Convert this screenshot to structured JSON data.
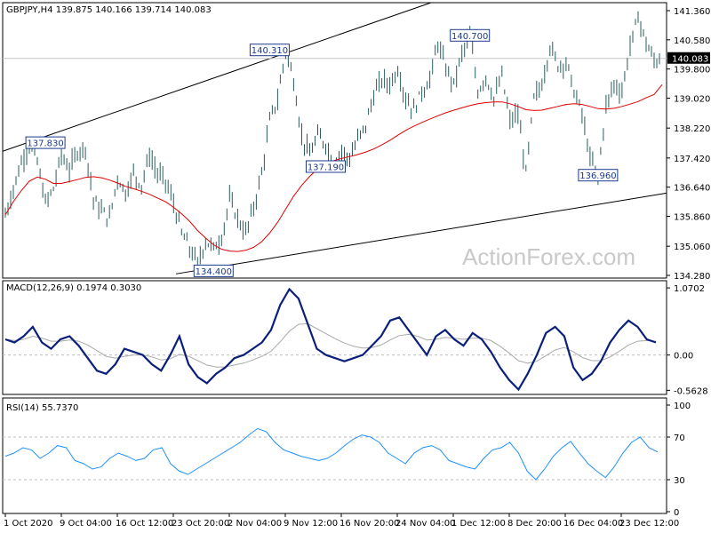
{
  "chart_data": [
    {
      "type": "line",
      "pane": "price",
      "title": "GBPJPY,H4  139.875 140.166 139.714 140.083",
      "symbol": "GBPJPY",
      "timeframe": "H4",
      "ohlc_header": {
        "open": 139.875,
        "high": 140.166,
        "low": 139.714,
        "close": 140.083
      },
      "last_price": "140.083",
      "watermark": "ActionForex.com",
      "ylim": [
        134.28,
        141.36
      ],
      "y_ticks": [
        "141.360",
        "140.580",
        "139.800",
        "139.020",
        "138.220",
        "137.420",
        "136.640",
        "135.860",
        "135.060",
        "134.280"
      ],
      "x_ticks": [
        "1 Oct 2020",
        "9 Oct 04:00",
        "16 Oct 12:00",
        "23 Oct 20:00",
        "2 Nov 04:00",
        "9 Nov 12:00",
        "16 Nov 20:00",
        "24 Nov 04:00",
        "1 Dec 12:00",
        "8 Dec 20:00",
        "16 Dec 04:00",
        "23 Dec 12:00"
      ],
      "price_path": [
        135.9,
        136.6,
        137.3,
        137.8,
        137.3,
        136.2,
        136.6,
        137.5,
        137.1,
        137.6,
        137.7,
        136.3,
        136.0,
        135.8,
        136.9,
        136.5,
        137.0,
        136.7,
        137.5,
        137.0,
        136.8,
        136.2,
        135.4,
        135.0,
        134.6,
        135.2,
        135.0,
        135.3,
        136.3,
        135.8,
        135.4,
        136.1,
        137.0,
        138.4,
        139.0,
        140.3,
        139.5,
        138.0,
        137.5,
        138.0,
        137.8,
        137.3,
        137.6,
        137.4,
        137.9,
        138.3,
        139.1,
        139.5,
        139.4,
        139.8,
        139.0,
        138.7,
        139.2,
        139.5,
        140.5,
        139.8,
        139.4,
        140.2,
        140.7,
        139.2,
        139.6,
        139.0,
        139.6,
        138.4,
        138.6,
        137.0,
        139.0,
        139.4,
        140.4,
        139.9,
        140.0,
        139.2,
        138.6,
        137.4,
        136.96,
        138.8,
        139.4,
        139.2,
        140.4,
        141.2,
        140.5,
        140.0,
        140.1
      ],
      "series": [
        {
          "name": "",
          "values": [
            135.9,
            136.25,
            136.55,
            136.8,
            136.91,
            136.85,
            136.74,
            136.74,
            136.79,
            136.84,
            136.9,
            136.92,
            136.89,
            136.83,
            136.75,
            136.66,
            136.6,
            136.53,
            136.45,
            136.35,
            136.25,
            136.1,
            135.93,
            135.73,
            135.48,
            135.28,
            135.1,
            134.98,
            134.93,
            134.92,
            134.95,
            135.03,
            135.18,
            135.41,
            135.7,
            136.05,
            136.4,
            136.69,
            136.93,
            137.13,
            137.27,
            137.35,
            137.41,
            137.46,
            137.51,
            137.58,
            137.66,
            137.77,
            137.89,
            138.03,
            138.16,
            138.27,
            138.37,
            138.46,
            138.55,
            138.63,
            138.7,
            138.76,
            138.82,
            138.87,
            138.9,
            138.92,
            138.92,
            138.87,
            138.8,
            138.71,
            138.69,
            138.7,
            138.75,
            138.8,
            138.85,
            138.87,
            138.85,
            138.8,
            138.74,
            138.73,
            138.75,
            138.8,
            138.86,
            138.93,
            139.03,
            139.12,
            139.38
          ]
        }
      ],
      "labels": [
        {
          "text": "137.830",
          "x": 5,
          "y": 137.83
        },
        {
          "text": "140.310",
          "x": 33,
          "y": 140.31
        },
        {
          "text": "140.700",
          "x": 58,
          "y": 140.7
        },
        {
          "text": "137.190",
          "x": 40,
          "y": 137.19
        },
        {
          "text": "136.960",
          "x": 74,
          "y": 136.96
        },
        {
          "text": "134.400",
          "x": 26,
          "y": 134.4
        }
      ]
    },
    {
      "type": "line",
      "pane": "macd",
      "title": "MACD(12,26,9) 0.1974 0.3030",
      "ylim": [
        -0.6,
        1.1
      ],
      "y_ticks": [
        "1.0702",
        "0.00",
        "-0.5628"
      ],
      "series": [
        {
          "name": "MACD",
          "values": [
            0.25,
            0.2,
            0.3,
            0.45,
            0.2,
            0.1,
            0.25,
            0.3,
            0.15,
            -0.05,
            -0.25,
            -0.3,
            -0.15,
            0.1,
            0.05,
            0.0,
            -0.15,
            -0.25,
            0.0,
            0.3,
            -0.15,
            -0.35,
            -0.45,
            -0.3,
            -0.2,
            -0.05,
            0.0,
            0.1,
            0.2,
            0.4,
            0.8,
            1.05,
            0.9,
            0.5,
            0.1,
            0.0,
            -0.05,
            -0.1,
            -0.05,
            0.0,
            0.15,
            0.3,
            0.55,
            0.6,
            0.4,
            0.2,
            0.0,
            0.3,
            0.4,
            0.25,
            0.15,
            0.35,
            0.25,
            0.05,
            -0.2,
            -0.4,
            -0.55,
            -0.3,
            0.0,
            0.35,
            0.45,
            0.3,
            -0.2,
            -0.4,
            -0.3,
            -0.1,
            0.2,
            0.4,
            0.55,
            0.45,
            0.25,
            0.2
          ]
        },
        {
          "name": "Signal",
          "values": [
            0.25,
            0.23,
            0.25,
            0.3,
            0.27,
            0.22,
            0.22,
            0.24,
            0.22,
            0.16,
            0.07,
            -0.02,
            -0.05,
            -0.02,
            0.0,
            0.0,
            -0.03,
            -0.08,
            -0.06,
            0.01,
            -0.02,
            -0.09,
            -0.16,
            -0.19,
            -0.19,
            -0.16,
            -0.13,
            -0.08,
            -0.02,
            0.06,
            0.21,
            0.38,
            0.49,
            0.5,
            0.42,
            0.34,
            0.26,
            0.19,
            0.14,
            0.11,
            0.12,
            0.16,
            0.24,
            0.31,
            0.33,
            0.3,
            0.24,
            0.25,
            0.28,
            0.27,
            0.25,
            0.27,
            0.27,
            0.23,
            0.14,
            0.03,
            -0.09,
            -0.13,
            -0.1,
            -0.01,
            0.08,
            0.12,
            0.05,
            -0.04,
            -0.09,
            -0.09,
            -0.03,
            0.06,
            0.16,
            0.22,
            0.23,
            0.22
          ]
        }
      ]
    },
    {
      "type": "line",
      "pane": "rsi",
      "title": "RSI(14) 55.7370",
      "ylim": [
        0,
        100
      ],
      "y_ticks": [
        "100",
        "70",
        "30",
        "0"
      ],
      "levels": [
        70,
        30
      ],
      "series": [
        {
          "name": "RSI",
          "values": [
            52,
            55,
            60,
            58,
            50,
            55,
            62,
            60,
            48,
            45,
            40,
            42,
            50,
            55,
            52,
            48,
            50,
            58,
            60,
            45,
            38,
            35,
            40,
            45,
            50,
            55,
            60,
            65,
            72,
            78,
            75,
            65,
            58,
            55,
            52,
            50,
            48,
            50,
            55,
            62,
            68,
            72,
            70,
            65,
            55,
            50,
            45,
            55,
            60,
            62,
            58,
            48,
            45,
            42,
            40,
            50,
            58,
            60,
            65,
            55,
            38,
            30,
            40,
            52,
            60,
            66,
            55,
            45,
            38,
            32,
            42,
            55,
            65,
            70,
            60,
            56
          ]
        }
      ]
    }
  ]
}
